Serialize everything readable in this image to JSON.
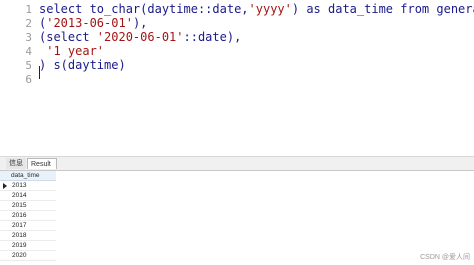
{
  "editor": {
    "line_numbers": [
      "1",
      "2",
      "3",
      "4",
      "5",
      "6"
    ],
    "lines": [
      [
        {
          "text": "select to_char(daytime::date,",
          "cls": "kw"
        },
        {
          "text": "'yyyy'",
          "cls": "str"
        },
        {
          "text": ") as data_time from generate_series(",
          "cls": "kw"
        }
      ],
      [
        {
          "text": "(",
          "cls": "kw"
        },
        {
          "text": "'2013-06-01'",
          "cls": "str"
        },
        {
          "text": "),",
          "cls": "kw"
        }
      ],
      [
        {
          "text": "(select ",
          "cls": "kw"
        },
        {
          "text": "'2020-06-01'",
          "cls": "str"
        },
        {
          "text": "::date),",
          "cls": "kw"
        }
      ],
      [
        {
          "text": " ",
          "cls": "kw"
        },
        {
          "text": "'1 year'",
          "cls": "str"
        }
      ],
      [
        {
          "text": ") s(daytime)",
          "cls": "kw"
        }
      ],
      [
        {
          "text": "",
          "cls": "kw"
        }
      ]
    ]
  },
  "tabs": {
    "info_label": "信息",
    "result_label": "Result 1"
  },
  "grid": {
    "column_header": "data_time",
    "rows": [
      "2013",
      "2014",
      "2015",
      "2016",
      "2017",
      "2018",
      "2019",
      "2020"
    ],
    "current_row": 0
  },
  "watermark": "CSDN @爱人间"
}
